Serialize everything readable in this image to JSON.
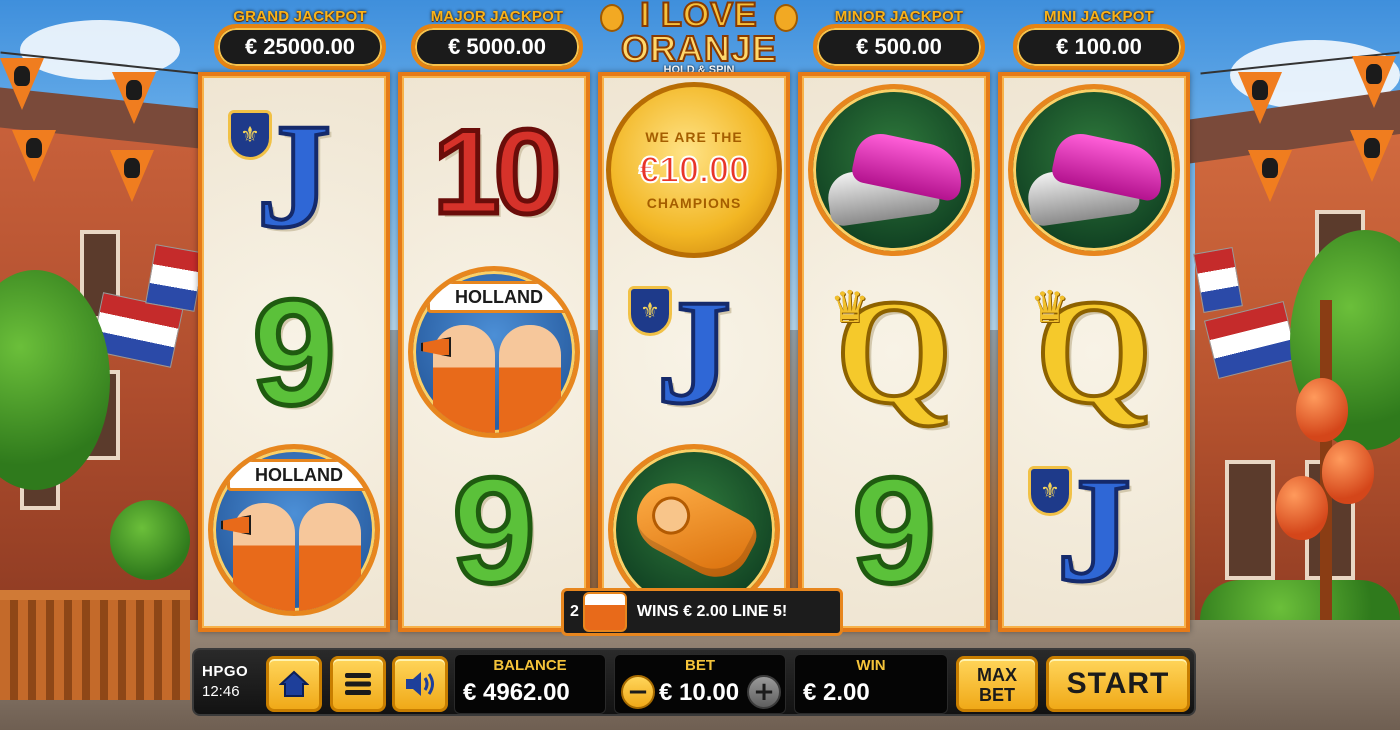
{
  "game": {
    "logo_line1": "I LOVE",
    "logo_line2": "ORANJE",
    "logo_line3": "HOLD & SPIN"
  },
  "jackpots": [
    {
      "title": "GRAND JACKPOT",
      "value": "€ 25000.00",
      "color": "#e7861e"
    },
    {
      "title": "MAJOR JACKPOT",
      "value": "€ 5000.00",
      "color": "#e7861e"
    },
    {
      "title": "MINOR JACKPOT",
      "value": "€ 500.00",
      "color": "#e7861e"
    },
    {
      "title": "MINI JACKPOT",
      "value": "€ 100.00",
      "color": "#e7861e"
    }
  ],
  "reels": [
    {
      "symbols": [
        {
          "type": "letter",
          "text": "J",
          "icon": "fleur-de-lis-shield-icon"
        },
        {
          "type": "number",
          "text": "9"
        },
        {
          "type": "fans",
          "banner": "HOLLAND"
        }
      ]
    },
    {
      "symbols": [
        {
          "type": "number",
          "text": "10"
        },
        {
          "type": "fans",
          "banner": "HOLLAND"
        },
        {
          "type": "number",
          "text": "9"
        }
      ]
    },
    {
      "symbols": [
        {
          "type": "coin",
          "top": "WE ARE THE",
          "value": "€10.00",
          "bottom": "CHAMPIONS"
        },
        {
          "type": "letter",
          "text": "J",
          "icon": "fleur-de-lis-shield-icon"
        },
        {
          "type": "whistle"
        }
      ]
    },
    {
      "symbols": [
        {
          "type": "boots"
        },
        {
          "type": "letter",
          "text": "Q",
          "icon": "crown-icon"
        },
        {
          "type": "number",
          "text": "9"
        }
      ]
    },
    {
      "symbols": [
        {
          "type": "boots"
        },
        {
          "type": "letter",
          "text": "Q",
          "icon": "crown-icon"
        },
        {
          "type": "letter",
          "text": "J",
          "icon": "fleur-de-lis-shield-icon"
        }
      ]
    }
  ],
  "win_message": {
    "count": "2",
    "text": "WINS € 2.00 LINE 5!",
    "symbol_banner": "HOLLAND"
  },
  "controls": {
    "brand": "HPGO",
    "clock": "12:46",
    "home_icon": "home-icon",
    "menu_icon": "menu-icon",
    "sound_icon": "speaker-icon",
    "balance_label": "BALANCE",
    "balance_value": "€ 4962.00",
    "bet_label": "BET",
    "bet_value": "€ 10.00",
    "bet_minus": "−",
    "bet_plus": "+",
    "win_label": "WIN",
    "win_value": "€ 2.00",
    "maxbet_line1": "MAX",
    "maxbet_line2": "BET",
    "start_label": "START"
  },
  "colors": {
    "accent_orange": "#e7861e",
    "gold": "#f4c33a",
    "button_yellow": "#ffd55a",
    "panel_black": "#050505"
  }
}
